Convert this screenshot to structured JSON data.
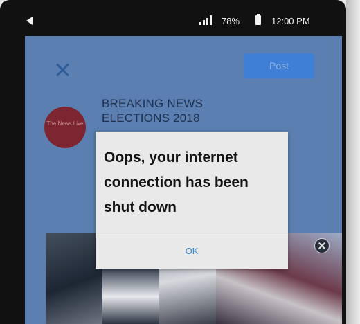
{
  "status_bar": {
    "battery": "78%",
    "time": "12:00 PM",
    "icons": [
      "back-icon",
      "signal-icon",
      "battery-icon"
    ]
  },
  "compose": {
    "post_label": "Post",
    "close_icon": "close-icon"
  },
  "avatar": {
    "text": "The News Live",
    "color": "#7d2531"
  },
  "headline": {
    "line1": "BREAKING NEWS",
    "line2": "ELECTIONS 2018"
  },
  "dialog": {
    "message": "Oops, your internet connection has been shut down",
    "ok_label": "OK"
  },
  "colors": {
    "screen_bg": "#5b7fb1",
    "post_button": "#3f7fd6",
    "ok_text": "#2f86d6"
  }
}
